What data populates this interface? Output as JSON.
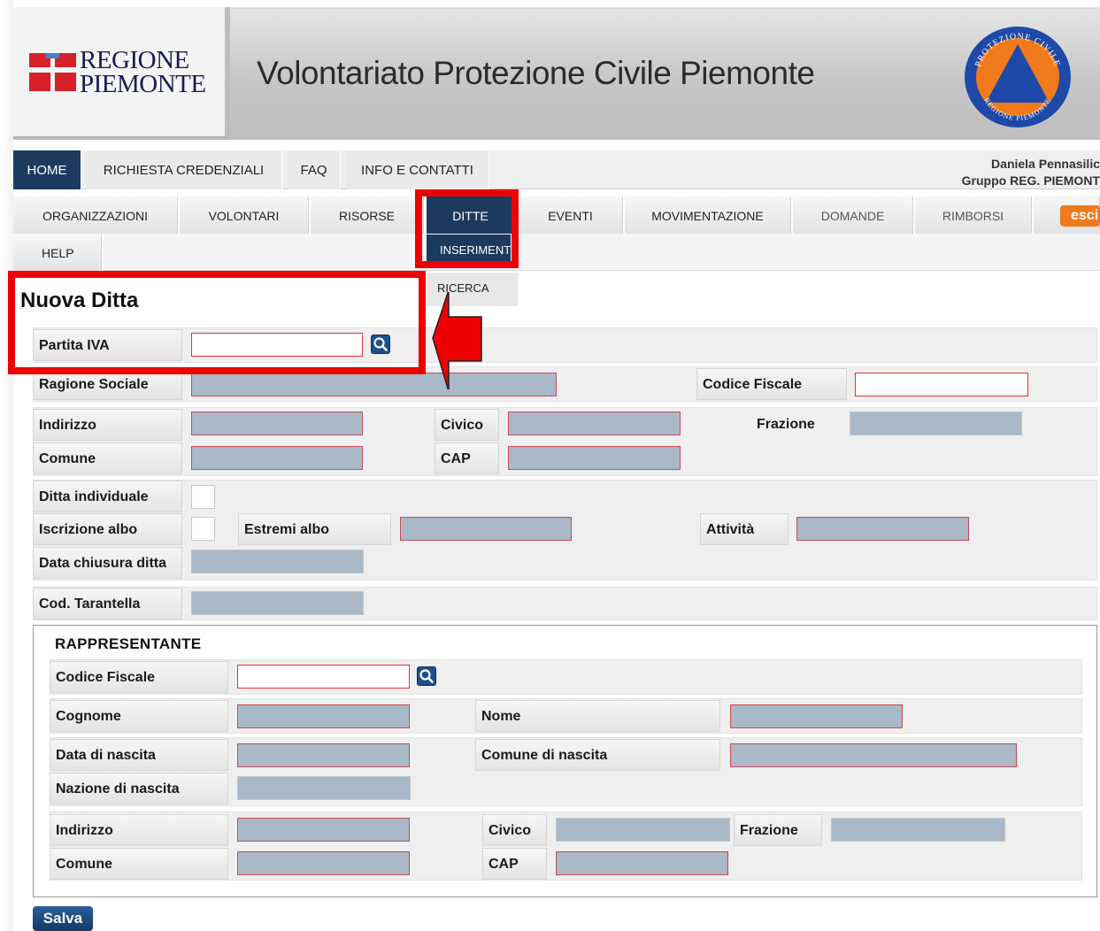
{
  "header": {
    "region_line1": "REGIONE",
    "region_line2": "PIEMONTE",
    "site_title": "Volontariato Protezione Civile Piemonte",
    "emblem_top_text": "PROTEZIONE CIVILE",
    "emblem_bottom_text": "REGIONE PIEMONTE"
  },
  "topnav": {
    "items": [
      {
        "label": "HOME",
        "active": true
      },
      {
        "label": "RICHIESTA CREDENZIALI",
        "active": false
      },
      {
        "label": "FAQ",
        "active": false
      },
      {
        "label": "INFO E CONTATTI",
        "active": false
      }
    ]
  },
  "user": {
    "name": "Daniela Pennasilic",
    "group": "Gruppo REG. PIEMONT"
  },
  "subnav": {
    "items": [
      {
        "label": "ORGANIZZAZIONI"
      },
      {
        "label": "VOLONTARI"
      },
      {
        "label": "RISORSE"
      },
      {
        "label": "DITTE",
        "active": true
      },
      {
        "label": "EVENTI"
      },
      {
        "label": "MOVIMENTAZIONE"
      },
      {
        "label": "DOMANDE",
        "muted": true
      },
      {
        "label": "RIMBORSI",
        "muted": true
      },
      {
        "label": "esci"
      },
      {
        "label": "HELP"
      }
    ],
    "dropdown": [
      "INSERIMENT",
      "RICERCA"
    ]
  },
  "form": {
    "title": "Nuova Ditta",
    "labels": {
      "partita_iva": "Partita IVA",
      "ragione_sociale": "Ragione Sociale",
      "codice_fiscale": "Codice Fiscale",
      "indirizzo": "Indirizzo",
      "civico": "Civico",
      "frazione": "Frazione",
      "comune": "Comune",
      "cap": "CAP",
      "ditta_individuale": "Ditta individuale",
      "iscrizione_albo": "Iscrizione albo",
      "estremi_albo": "Estremi albo",
      "attivita": "Attività",
      "data_chiusura": "Data chiusura ditta",
      "cod_tarantella": "Cod. Tarantella"
    }
  },
  "representative": {
    "title": "RAPPRESENTANTE",
    "labels": {
      "codice_fiscale": "Codice Fiscale",
      "cognome": "Cognome",
      "nome": "Nome",
      "data_nascita": "Data di nascita",
      "comune_nascita": "Comune di nascita",
      "nazione_nascita": "Nazione di nascita",
      "indirizzo": "Indirizzo",
      "civico": "Civico",
      "frazione": "Frazione",
      "comune": "Comune",
      "cap": "CAP"
    }
  },
  "actions": {
    "save": "Salva"
  },
  "colors": {
    "nav_active": "#1b3a5e",
    "annotation": "#ee0000",
    "exit_button": "#f07b1a",
    "disabled_field": "#a9b9c8"
  }
}
